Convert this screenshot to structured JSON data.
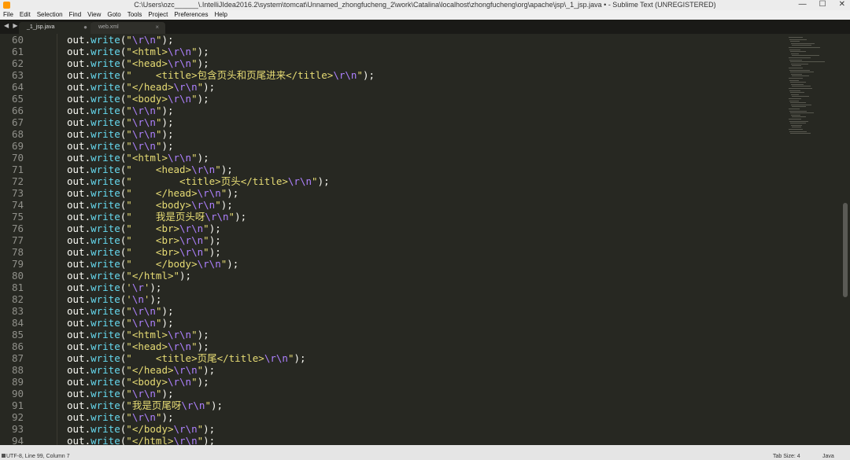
{
  "window": {
    "title": "C:\\Users\\ozc______\\.IntelliJIdea2016.2\\system\\tomcat\\Unnamed_zhongfucheng_2\\work\\Catalina\\localhost\\zhongfucheng\\org\\apache\\jsp\\_1_jsp.java • - Sublime Text (UNREGISTERED)",
    "minimize": "—",
    "maximize": "☐",
    "close": "✕"
  },
  "menu": [
    "File",
    "Edit",
    "Selection",
    "Find",
    "View",
    "Goto",
    "Tools",
    "Project",
    "Preferences",
    "Help"
  ],
  "tabs": [
    {
      "label": "_1_jsp.java",
      "close": "●",
      "active": true
    },
    {
      "label": "web.xml",
      "close": "×",
      "active": false
    }
  ],
  "tab_nav": {
    "prev": "◀",
    "next": "▶"
  },
  "code_lines": [
    {
      "n": "60",
      "s": "\\r\\n"
    },
    {
      "n": "61",
      "s": "<html>\\r\\n"
    },
    {
      "n": "62",
      "s": "<head>\\r\\n"
    },
    {
      "n": "63",
      "s": "    <title>包含页头和页尾进来</title>\\r\\n"
    },
    {
      "n": "64",
      "s": "</head>\\r\\n"
    },
    {
      "n": "65",
      "s": "<body>\\r\\n"
    },
    {
      "n": "66",
      "s": "\\r\\n"
    },
    {
      "n": "67",
      "s": "\\r\\n"
    },
    {
      "n": "68",
      "s": "\\r\\n"
    },
    {
      "n": "69",
      "s": "\\r\\n"
    },
    {
      "n": "70",
      "s": "<html>\\r\\n"
    },
    {
      "n": "71",
      "s": "    <head>\\r\\n"
    },
    {
      "n": "72",
      "s": "        <title>页头</title>\\r\\n"
    },
    {
      "n": "73",
      "s": "    </head>\\r\\n"
    },
    {
      "n": "74",
      "s": "    <body>\\r\\n"
    },
    {
      "n": "75",
      "s": "    我是页头呀\\r\\n"
    },
    {
      "n": "76",
      "s": "    <br>\\r\\n"
    },
    {
      "n": "77",
      "s": "    <br>\\r\\n"
    },
    {
      "n": "78",
      "s": "    <br>\\r\\n"
    },
    {
      "n": "79",
      "s": "    </body>\\r\\n"
    },
    {
      "n": "80",
      "s": "</html>"
    },
    {
      "n": "81",
      "s": "\\r",
      "q": "'"
    },
    {
      "n": "82",
      "s": "\\n",
      "q": "'"
    },
    {
      "n": "83",
      "s": "\\r\\n"
    },
    {
      "n": "84",
      "s": "\\r\\n"
    },
    {
      "n": "85",
      "s": "<html>\\r\\n"
    },
    {
      "n": "86",
      "s": "<head>\\r\\n"
    },
    {
      "n": "87",
      "s": "    <title>页尾</title>\\r\\n"
    },
    {
      "n": "88",
      "s": "</head>\\r\\n"
    },
    {
      "n": "89",
      "s": "<body>\\r\\n"
    },
    {
      "n": "90",
      "s": "\\r\\n"
    },
    {
      "n": "91",
      "s": "我是页尾呀\\r\\n"
    },
    {
      "n": "92",
      "s": "\\r\\n"
    },
    {
      "n": "93",
      "s": "</body>\\r\\n"
    },
    {
      "n": "94",
      "s": "</html>\\r\\n"
    }
  ],
  "code_tokens": {
    "object": "out",
    "dot": ".",
    "method": "write",
    "open": "(",
    "close": ");"
  },
  "status": {
    "left": "UTF-8, Line 99, Column 7",
    "tab_size": "Tab Size: 4",
    "syntax": "Java"
  },
  "colors": {
    "background": "#272822",
    "string": "#e6db74",
    "escape": "#ae81ff",
    "function": "#66d9ef",
    "line_number": "#90908a"
  }
}
